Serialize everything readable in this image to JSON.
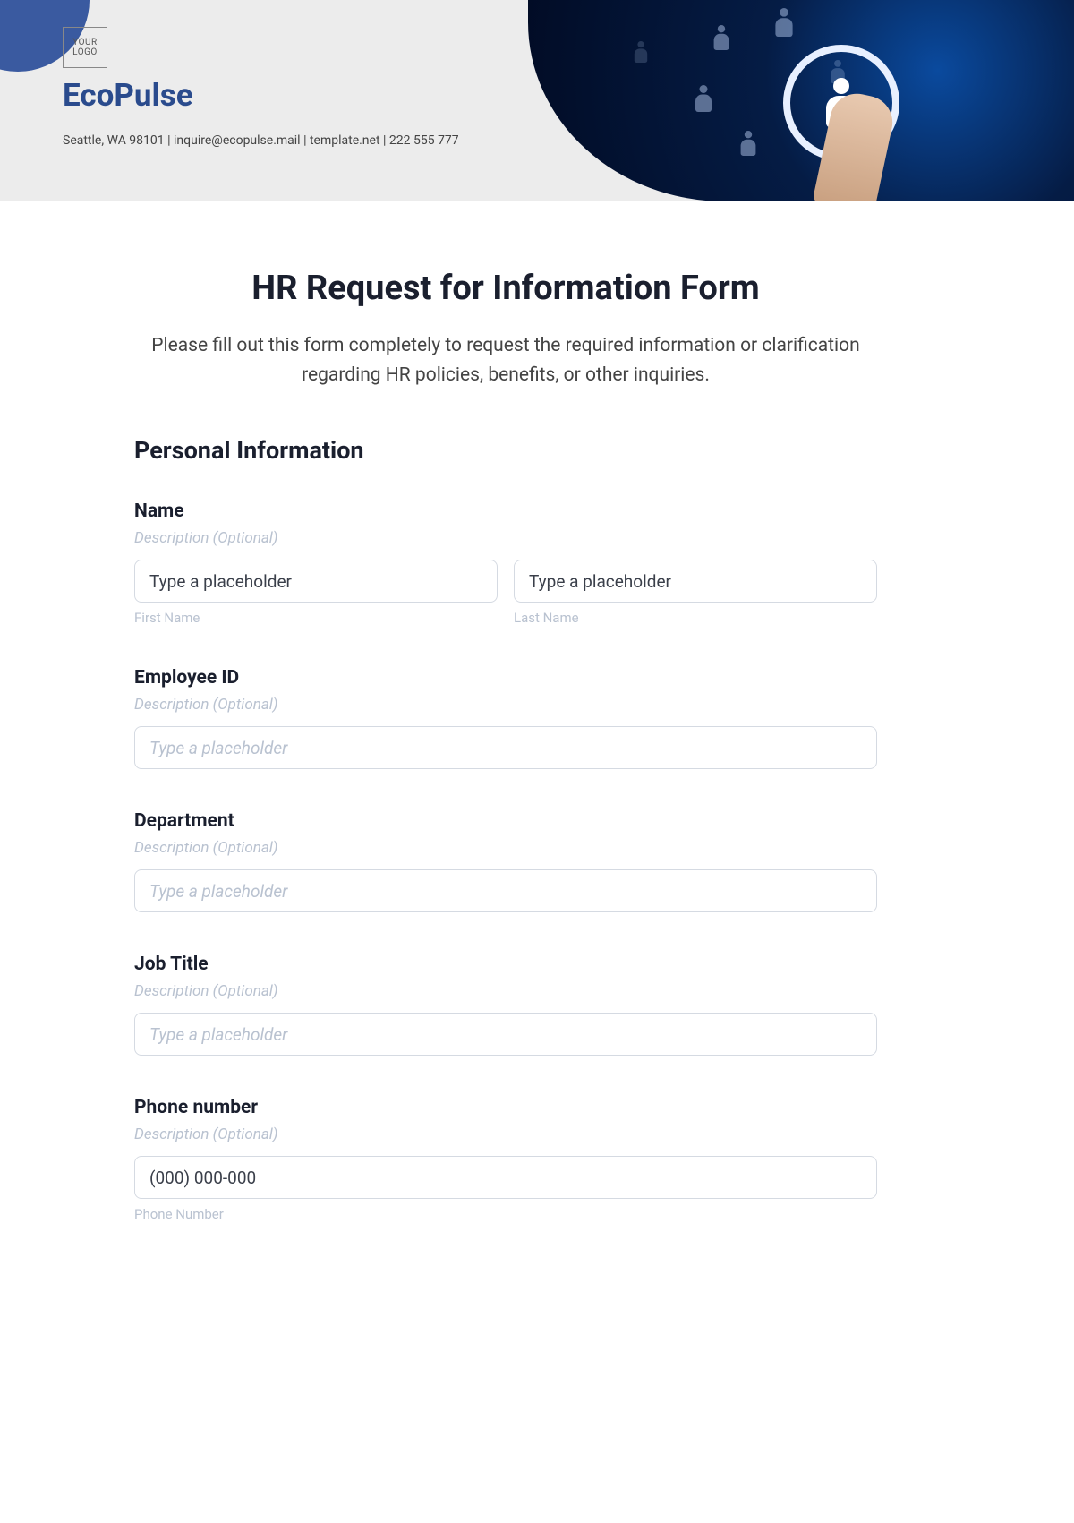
{
  "header": {
    "logo_line1": "YOUR",
    "logo_line2": "LOGO",
    "brand": "EcoPulse",
    "contact": "Seattle, WA 98101 | inquire@ecopulse.mail | template.net | 222 555 777"
  },
  "form": {
    "title": "HR Request for Information Form",
    "description": "Please fill out this form completely to request the required information or clarification regarding HR policies, benefits, or other inquiries.",
    "section_personal": "Personal Information",
    "fields": {
      "name": {
        "label": "Name",
        "desc": "Description (Optional)",
        "first_placeholder": "Type a placeholder",
        "last_placeholder": "Type a placeholder",
        "first_sub": "First Name",
        "last_sub": "Last Name"
      },
      "employee_id": {
        "label": "Employee ID",
        "desc": "Description (Optional)",
        "placeholder": "Type a placeholder"
      },
      "department": {
        "label": "Department",
        "desc": "Description (Optional)",
        "placeholder": "Type a placeholder"
      },
      "job_title": {
        "label": "Job Title",
        "desc": "Description (Optional)",
        "placeholder": "Type a placeholder"
      },
      "phone": {
        "label": "Phone number",
        "desc": "Description (Optional)",
        "value": "(000) 000-000",
        "sub": "Phone Number"
      }
    }
  }
}
